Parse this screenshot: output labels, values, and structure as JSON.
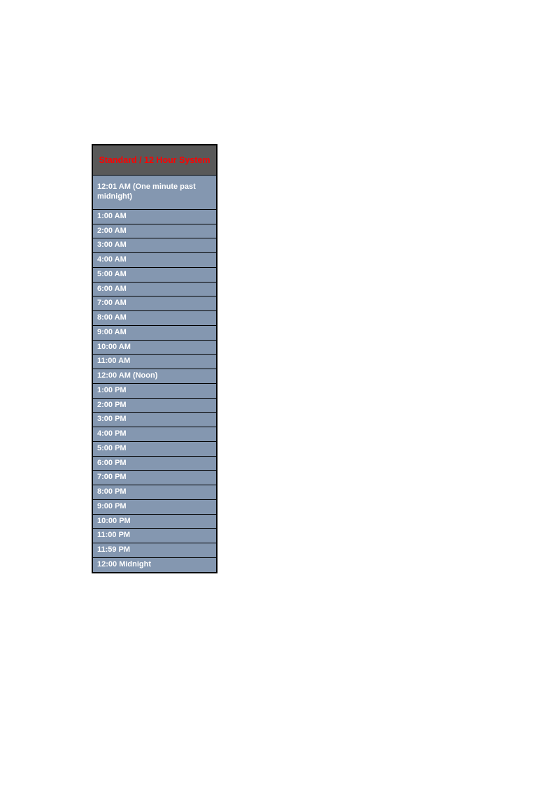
{
  "header": "Standard / 12 Hour System",
  "rows": [
    "12:01 AM (One minute past midnight)",
    "1:00 AM",
    "2:00 AM",
    "3:00 AM",
    "4:00 AM",
    "5:00 AM",
    "6:00 AM",
    "7:00 AM",
    "8:00 AM",
    "9:00 AM",
    "10:00 AM",
    "11:00 AM",
    "12:00 AM (Noon)",
    "1:00 PM",
    "2:00 PM",
    "3:00 PM",
    "4:00 PM",
    "5:00 PM",
    "6:00 PM",
    "7:00 PM",
    "8:00 PM",
    "9:00 PM",
    "10:00 PM",
    "11:00 PM",
    "11:59 PM",
    "12:00 Midnight"
  ]
}
